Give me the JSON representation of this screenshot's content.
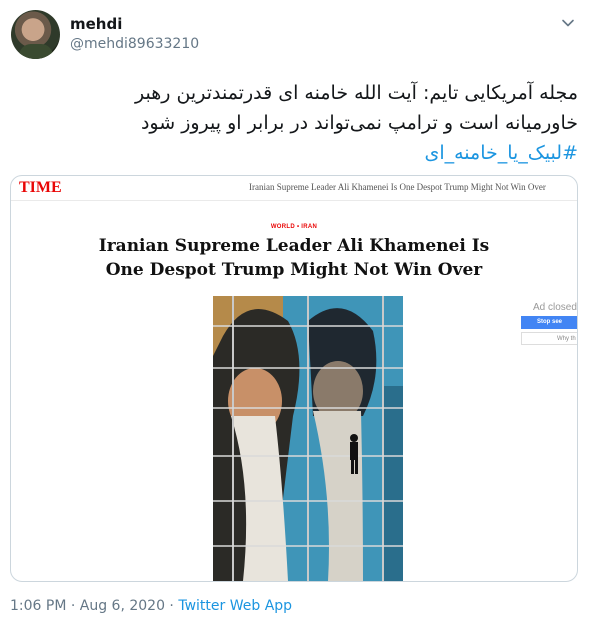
{
  "tweet": {
    "author_name": "mehdi",
    "author_handle": "@mehdi89633210",
    "text_lines": [
      "مجله آمریکایی تایم: آیت الله خامنه ای قدرتمندترین رهبر",
      "خاورمیانه است و ترامپ نمی‌تواند در برابر او پیروز شود"
    ],
    "hashtag": "#لبیک_یا_خامنه_ای",
    "timestamp": "1:06 PM · Aug 6, 2020 · ",
    "source": "Twitter Web App"
  },
  "card": {
    "brand": "TIME",
    "mini_headline": "Iranian Supreme Leader Ali Khamenei Is One Despot Trump Might Not Win Over",
    "kicker": "WORLD • IRAN",
    "headline_line1": "Iranian Supreme Leader Ali Khamenei Is",
    "headline_line2": "One Despot Trump Might Not Win Over",
    "ad": {
      "label": "Ad closed",
      "stop_button": "Stop see",
      "why_button": "Why th"
    }
  },
  "icons": {
    "menu": "chevron-down-icon"
  },
  "colors": {
    "link": "#1b95e0",
    "time_red": "#e90606",
    "meta_gray": "#657786"
  }
}
